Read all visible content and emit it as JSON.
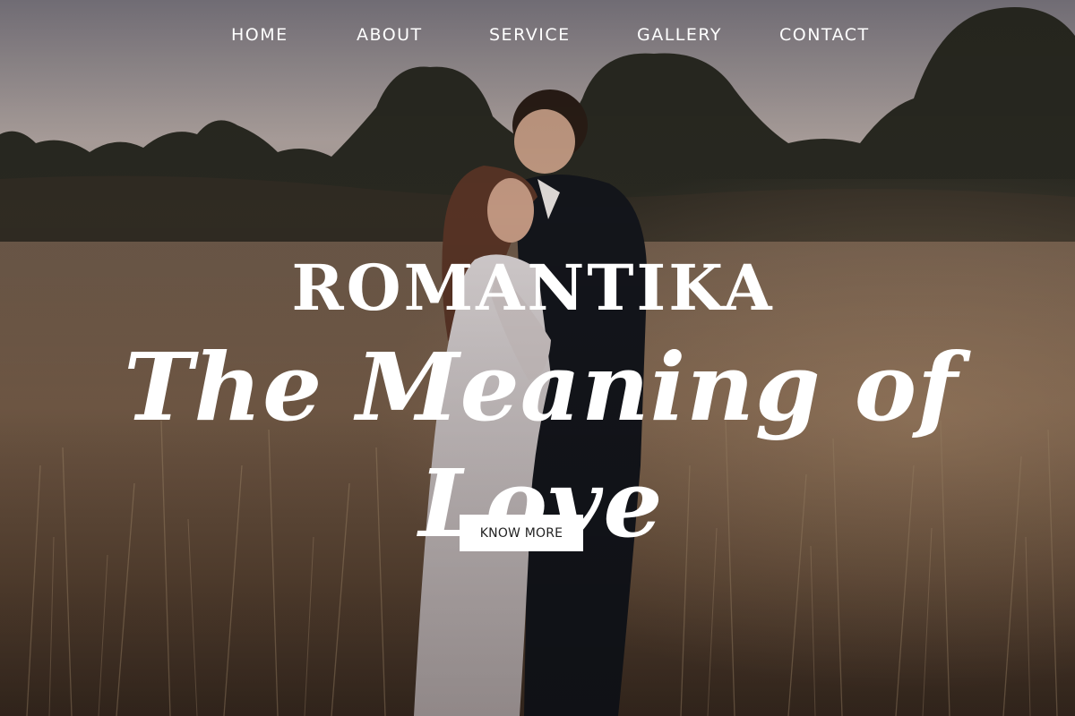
{
  "nav": {
    "items": [
      {
        "label": "HOME"
      },
      {
        "label": "ABOUT"
      },
      {
        "label": "SERVICE"
      },
      {
        "label": "GALLERY"
      },
      {
        "label": "CONTACT"
      }
    ]
  },
  "hero": {
    "brand": "ROMANTIKA",
    "tagline": "The Meaning of Love",
    "cta_label": "KNOW MORE",
    "background_image": "couple-embracing-in-tall-grass-field-at-dusk"
  },
  "colors": {
    "text": "#ffffff",
    "button_bg": "#ffffff",
    "button_text": "#222222",
    "sky": "#a79a98",
    "grass": "#6a5140"
  }
}
